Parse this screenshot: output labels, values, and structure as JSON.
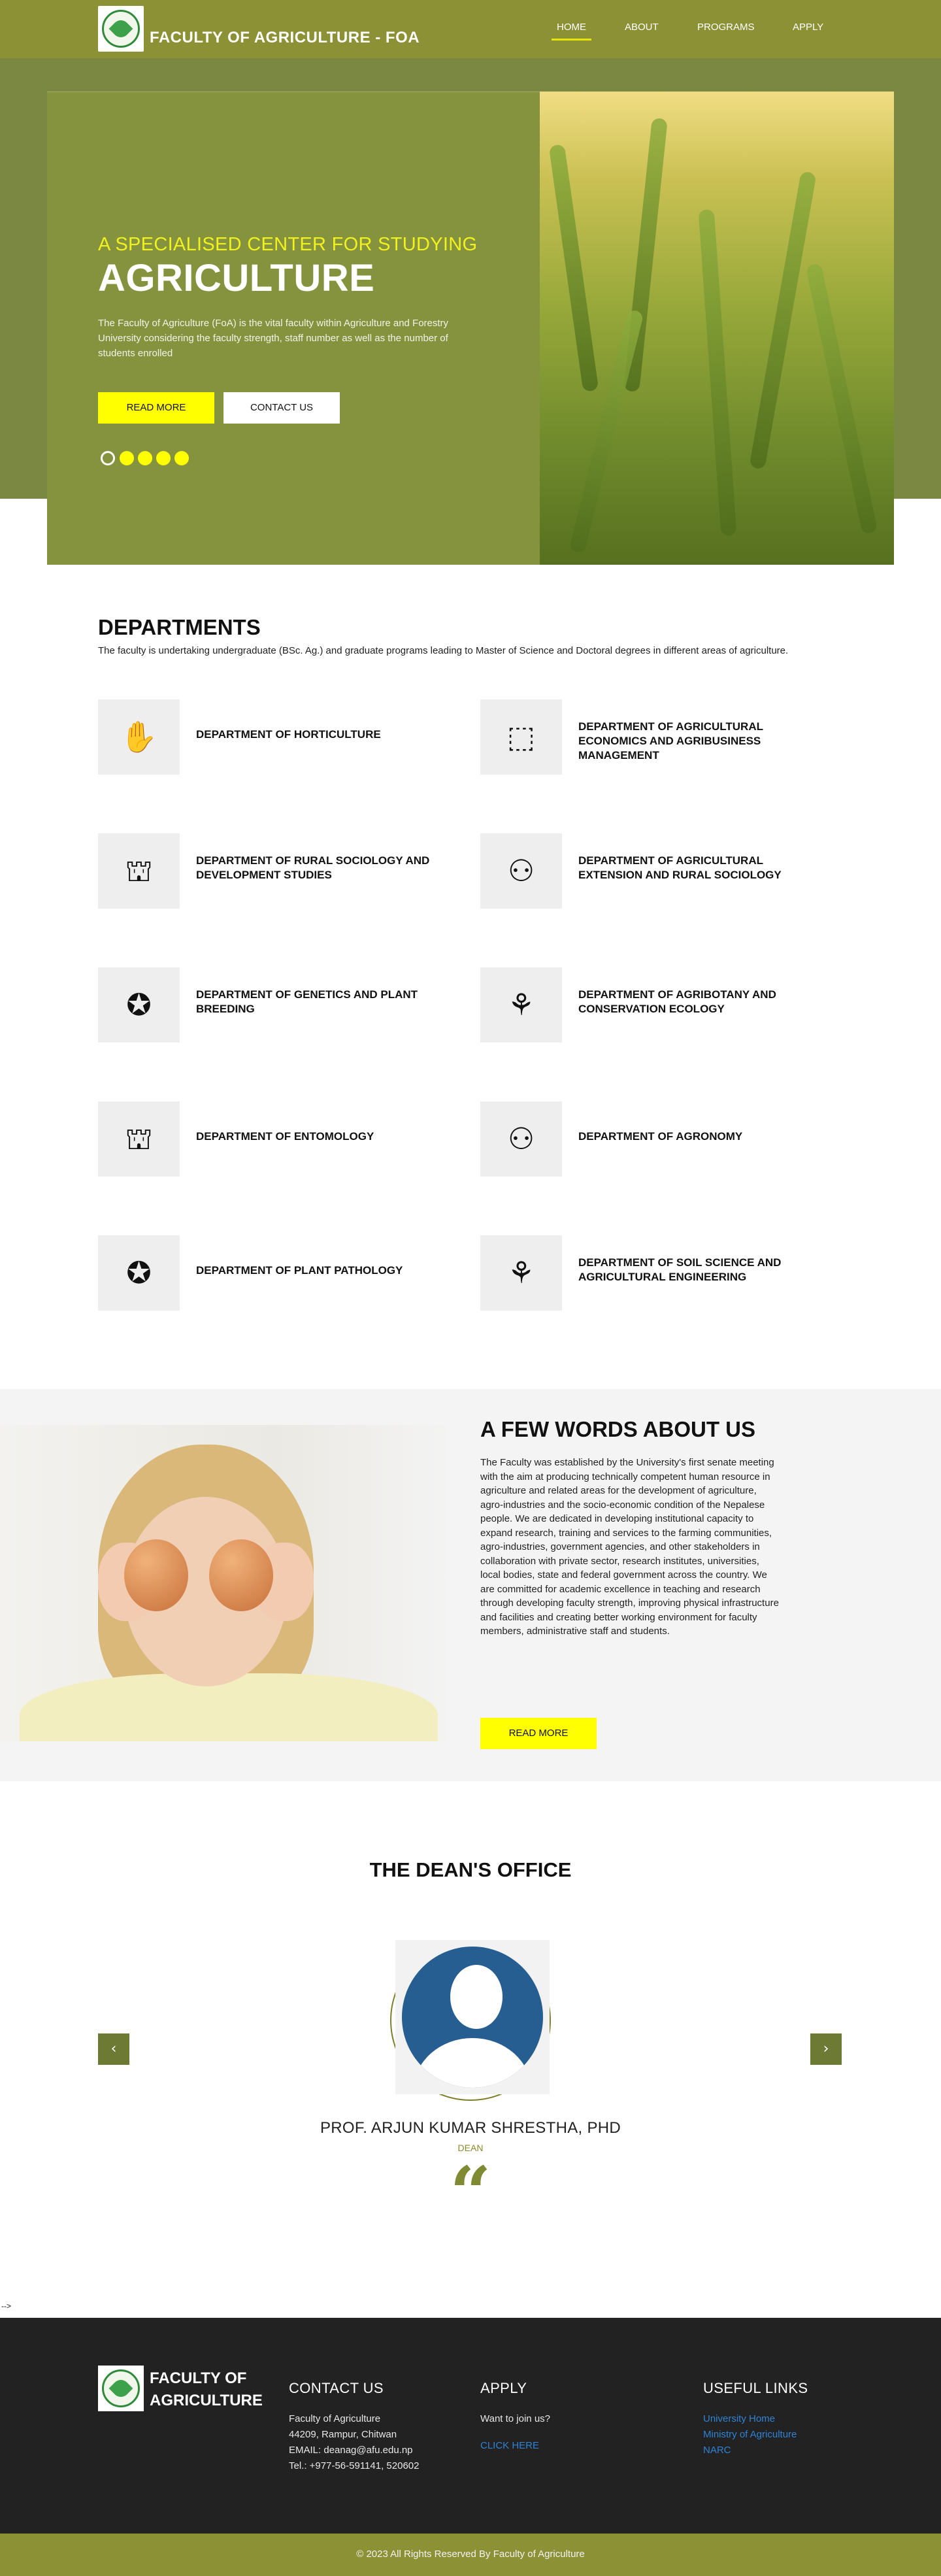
{
  "header": {
    "brand": "FACULTY OF AGRICULTURE - FOA",
    "nav": [
      "HOME",
      "ABOUT",
      "PROGRAMS",
      "APPLY"
    ],
    "active_nav": "HOME"
  },
  "hero": {
    "subtitle": "A SPECIALISED CENTER FOR STUDYING",
    "title": "AGRICULTURE",
    "description": "The Faculty of Agriculture (FoA) is the vital faculty within Agriculture and Forestry University considering the faculty strength, staff number as well as the number of students enrolled",
    "read_more": "READ MORE",
    "contact_us": "CONTACT US",
    "slide_count": 5,
    "active_slide": 1
  },
  "departments": {
    "title": "DEPARTMENTS",
    "intro": "The faculty is undertaking undergraduate (BSc. Ag.) and graduate programs leading to Master of Science and Doctoral degrees in different areas of agriculture.",
    "items": [
      {
        "name": "DEPARTMENT OF HORTICULTURE",
        "icon": "hand-with-fruit-icon"
      },
      {
        "name": "DEPARTMENT OF AGRICULTURAL ECONOMICS AND AGRIBUSINESS MANAGEMENT",
        "icon": "frame-icon"
      },
      {
        "name": "DEPARTMENT OF RURAL SOCIOLOGY AND DEVELOPMENT STUDIES",
        "icon": "people-building-icon"
      },
      {
        "name": "DEPARTMENT OF AGRICULTURAL EXTENSION AND RURAL SOCIOLOGY",
        "icon": "teacher-audience-icon"
      },
      {
        "name": "DEPARTMENT OF GENETICS AND PLANT BREEDING",
        "icon": "award-ribbon-icon"
      },
      {
        "name": "DEPARTMENT OF AGRIBOTANY AND CONSERVATION ECOLOGY",
        "icon": "hands-globe-icon"
      },
      {
        "name": "DEPARTMENT OF ENTOMOLOGY",
        "icon": "people-building-icon"
      },
      {
        "name": "DEPARTMENT OF AGRONOMY",
        "icon": "teacher-audience-icon"
      },
      {
        "name": "DEPARTMENT OF PLANT PATHOLOGY",
        "icon": "award-ribbon-icon"
      },
      {
        "name": "DEPARTMENT OF SOIL SCIENCE AND AGRICULTURAL ENGINEERING",
        "icon": "hands-globe-icon"
      }
    ]
  },
  "about": {
    "title": "A FEW WORDS ABOUT US",
    "text": "The Faculty was established by the University's first senate meeting with the aim at producing technically competent human resource in agriculture and related areas for the development of agriculture, agro-industries and the socio-economic condition of the Nepalese people. We are dedicated in developing institutional capacity to expand research, training and services to the farming communities, agro-industries, government agencies, and other stakeholders in collaboration with private sector, research institutes, universities, local bodies, state and federal government across the country. We are committed for academic excellence in teaching and research through developing faculty strength, improving physical infrastructure and facilities and creating better working environment for faculty members, administrative staff and students.",
    "read_more": "READ MORE"
  },
  "dean": {
    "title": "THE DEAN'S OFFICE",
    "name": "PROF. ARJUN KUMAR SHRESTHA, PHD",
    "role": "DEAN",
    "quote_mark": "“",
    "prev": "‹",
    "next": "›"
  },
  "stray_text": "-->",
  "footer": {
    "brand_line1": "FACULTY OF",
    "brand_line2": "AGRICULTURE",
    "contact": {
      "heading": "CONTACT US",
      "lines": [
        "Faculty of Agriculture",
        "44209, Rampur, Chitwan",
        "EMAIL: deanag@afu.edu.np",
        "Tel.: +977-56-591141, 520602"
      ]
    },
    "apply": {
      "heading": "APPLY",
      "text": "Want to join us?",
      "link": "CLICK HERE"
    },
    "useful": {
      "heading": "USEFUL LINKS",
      "links": [
        "University Home",
        "Ministry of Agriculture",
        "NARC"
      ]
    },
    "copyright": "© 2023 All Rights Reserved By Faculty of Agriculture"
  },
  "colors": {
    "olive": "#8d9136",
    "hero_band": "#7b8841",
    "accent_yellow": "#ffff00",
    "footer_bg": "#222222",
    "link_blue": "#2f83d6"
  }
}
